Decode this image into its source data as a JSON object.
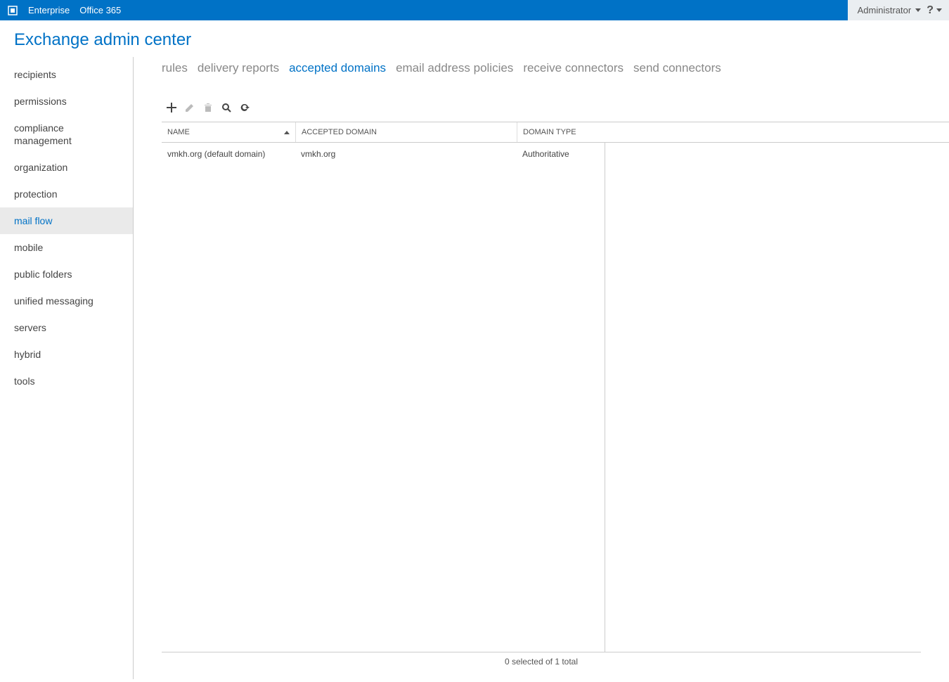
{
  "topbar": {
    "enterprise": "Enterprise",
    "office365": "Office 365",
    "user": "Administrator"
  },
  "header": {
    "title": "Exchange admin center"
  },
  "sidebar": {
    "items": [
      {
        "label": "recipients",
        "active": false
      },
      {
        "label": "permissions",
        "active": false
      },
      {
        "label": "compliance management",
        "active": false
      },
      {
        "label": "organization",
        "active": false
      },
      {
        "label": "protection",
        "active": false
      },
      {
        "label": "mail flow",
        "active": true
      },
      {
        "label": "mobile",
        "active": false
      },
      {
        "label": "public folders",
        "active": false
      },
      {
        "label": "unified messaging",
        "active": false
      },
      {
        "label": "servers",
        "active": false
      },
      {
        "label": "hybrid",
        "active": false
      },
      {
        "label": "tools",
        "active": false
      }
    ]
  },
  "tabs": {
    "items": [
      {
        "label": "rules",
        "active": false
      },
      {
        "label": "delivery reports",
        "active": false
      },
      {
        "label": "accepted domains",
        "active": true
      },
      {
        "label": "email address policies",
        "active": false
      },
      {
        "label": "receive connectors",
        "active": false
      },
      {
        "label": "send connectors",
        "active": false
      }
    ]
  },
  "table": {
    "columns": {
      "name": "NAME",
      "accepted_domain": "ACCEPTED DOMAIN",
      "domain_type": "DOMAIN TYPE"
    },
    "rows": [
      {
        "name": "vmkh.org (default domain)",
        "domain": "vmkh.org",
        "type": "Authoritative"
      }
    ],
    "footer": "0 selected of 1 total"
  }
}
